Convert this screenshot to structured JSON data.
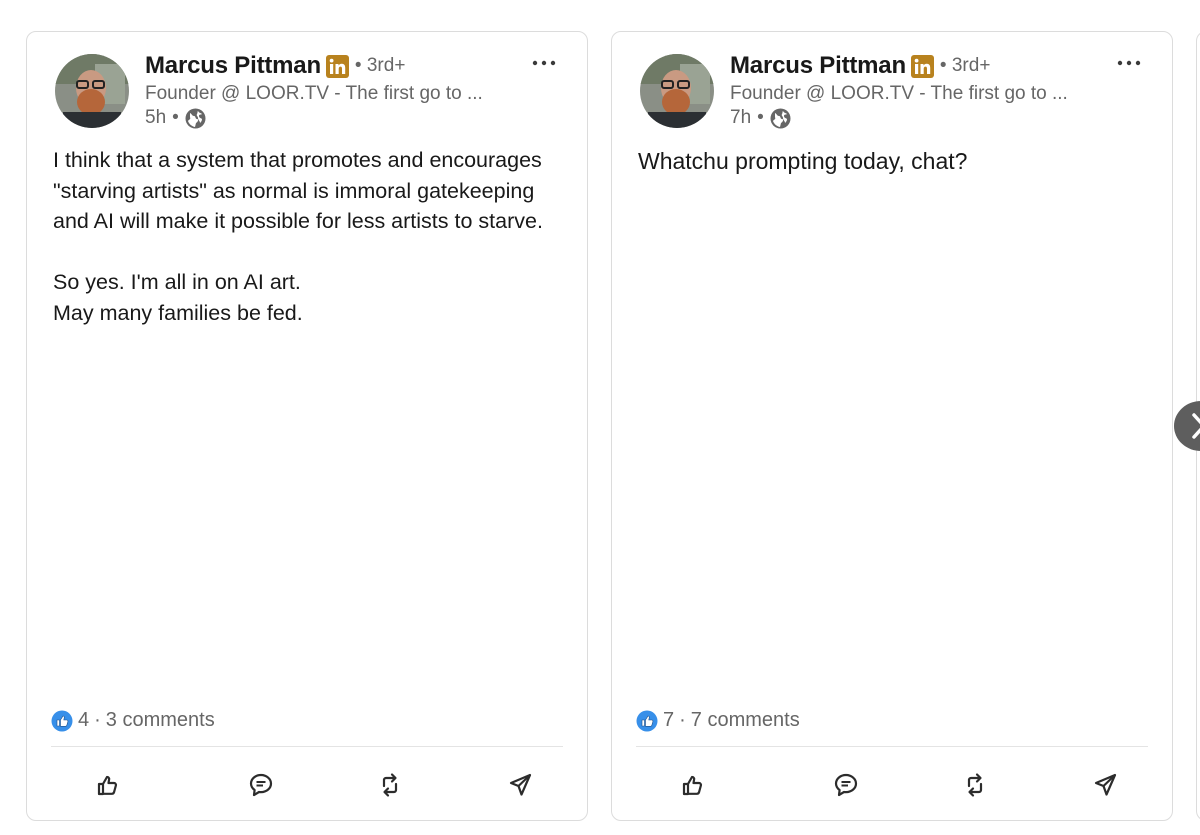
{
  "posts": [
    {
      "author": "Marcus Pittman",
      "degree": "3rd+",
      "headline": "Founder @ LOOR.TV - The first go to ...",
      "time": "5h",
      "bullet": "•",
      "paragraphs": [
        "I think that a system that promotes and encourages \"starving artists\" as normal is immoral gatekeeping and AI will make it possible for less artists to starve."
      ],
      "lines": [
        "So yes. I'm all in on AI art.",
        "May many families be fed."
      ],
      "reactions": "4",
      "dot": "·",
      "comments": "3 comments"
    },
    {
      "author": "Marcus Pittman",
      "degree": "3rd+",
      "headline": "Founder @ LOOR.TV - The first go to ...",
      "time": "7h",
      "bullet": "•",
      "text": "Whatchu prompting today, chat?",
      "reactions": "7",
      "dot": "·",
      "comments": "7 comments"
    }
  ],
  "icons": {
    "linkedin_badge": "linkedin-icon",
    "globe": "globe-icon",
    "more": "more-icon",
    "like": "like-icon",
    "comment": "comment-icon",
    "repost": "repost-icon",
    "send": "send-icon",
    "next": "chevron-right-icon"
  },
  "colors": {
    "linkedin_gold": "#b8821e",
    "like_blue": "#378fe9",
    "text_secondary": "#666666"
  }
}
